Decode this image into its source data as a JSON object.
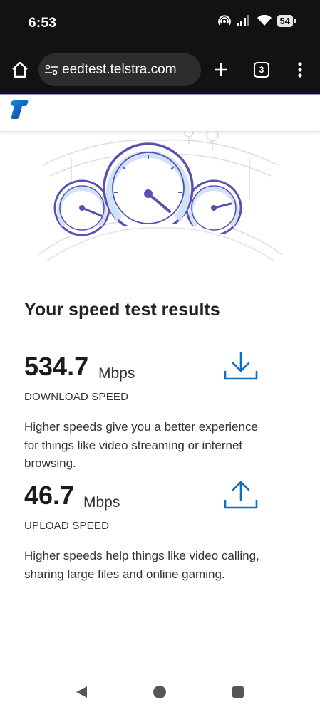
{
  "status_bar": {
    "time": "6:53",
    "battery": "54"
  },
  "browser": {
    "url": "eedtest.telstra.com",
    "tab_count": "3"
  },
  "site": {
    "logo": "telstra-logo"
  },
  "results": {
    "title": "Your speed test results",
    "download": {
      "value": "534.7",
      "unit": "Mbps",
      "label": "DOWNLOAD SPEED",
      "description": "Higher speeds give you a better experience for things like video streaming or internet browsing.",
      "icon": "download-icon"
    },
    "upload": {
      "value": "46.7",
      "unit": "Mbps",
      "label": "UPLOAD SPEED",
      "description": "Higher speeds help things like video calling, sharing large files and online gaming.",
      "icon": "upload-icon"
    }
  },
  "colors": {
    "brand_blue": "#0d6cc4",
    "gauge_purple": "#5b4fb3",
    "gauge_fill": "#cfe3f7",
    "chrome_bg": "#121212"
  }
}
